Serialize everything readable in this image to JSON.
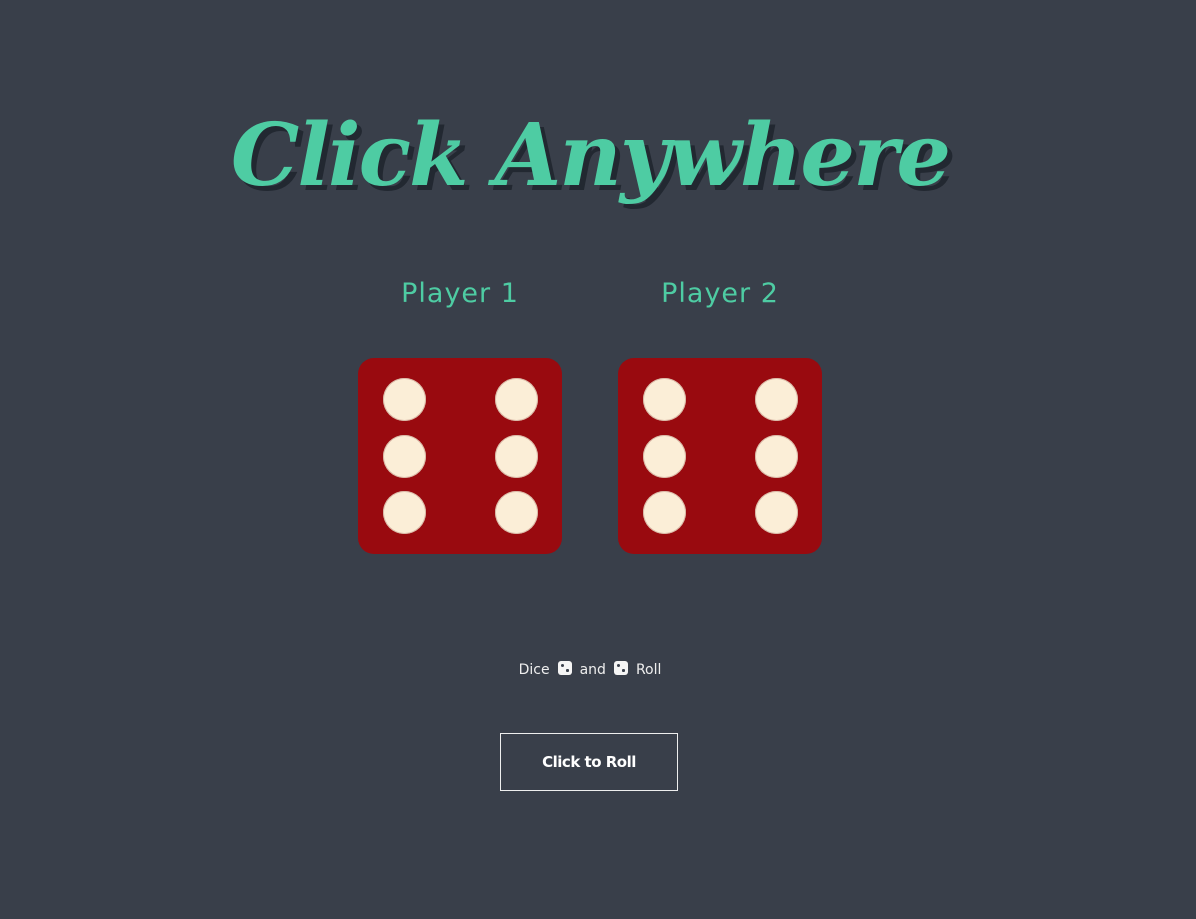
{
  "title": "Click Anywhere",
  "players": [
    {
      "label": "Player 1",
      "die_value": 6
    },
    {
      "label": "Player 2",
      "die_value": 6
    }
  ],
  "footer": {
    "word_1": "Dice",
    "icon_1": "die-icon",
    "word_2": "and",
    "icon_2": "die-icon",
    "word_3": "Roll"
  },
  "roll_button": {
    "label": "Click to Roll"
  },
  "colors": {
    "background": "#393f4a",
    "accent": "#4ecca3",
    "die_face": "#990a0f",
    "pip": "#fbeed7"
  }
}
